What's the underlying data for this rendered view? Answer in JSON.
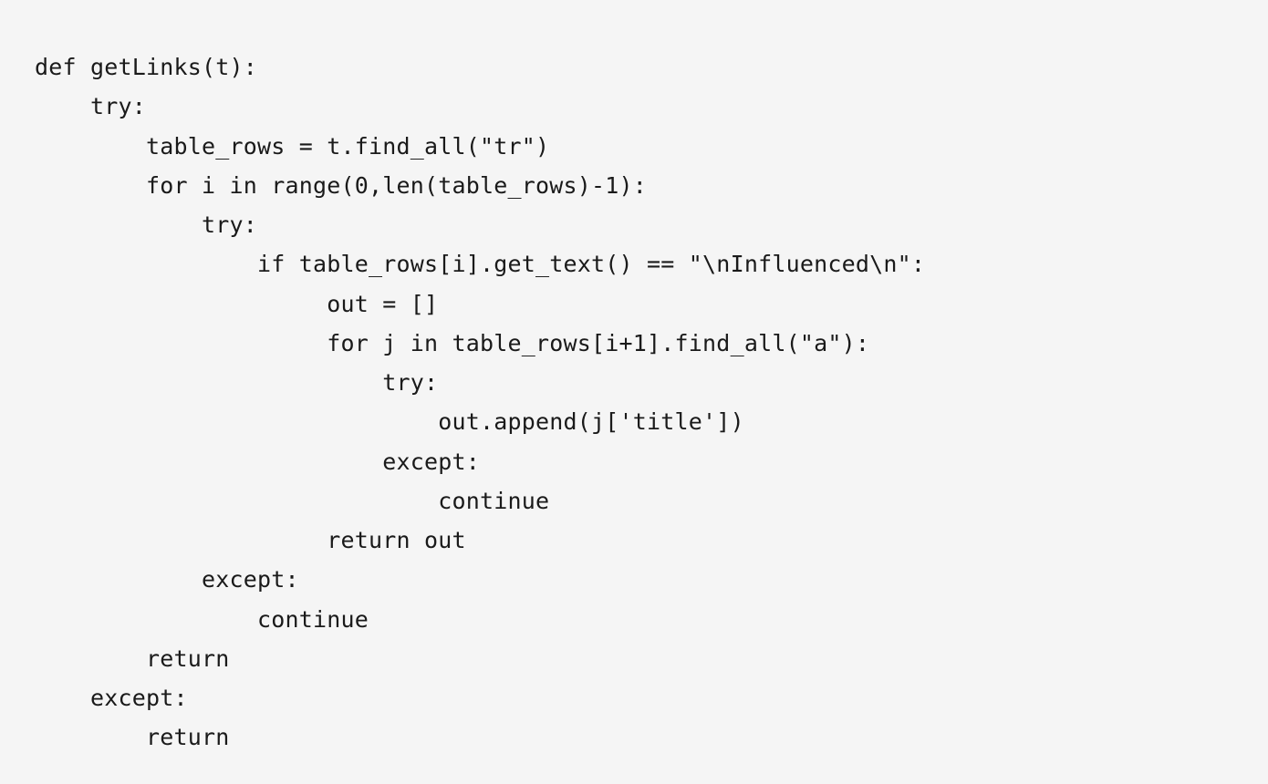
{
  "code": {
    "lines": [
      "def getLinks(t):",
      "    try:",
      "        table_rows = t.find_all(\"tr\")",
      "        for i in range(0,len(table_rows)-1):",
      "            try:",
      "                if table_rows[i].get_text() == \"\\nInfluenced\\n\":",
      "                     out = []",
      "                     for j in table_rows[i+1].find_all(\"a\"):",
      "                         try:",
      "                             out.append(j['title'])",
      "                         except:",
      "                             continue",
      "                     return out",
      "            except:",
      "                continue",
      "        return",
      "    except:",
      "        return"
    ]
  }
}
